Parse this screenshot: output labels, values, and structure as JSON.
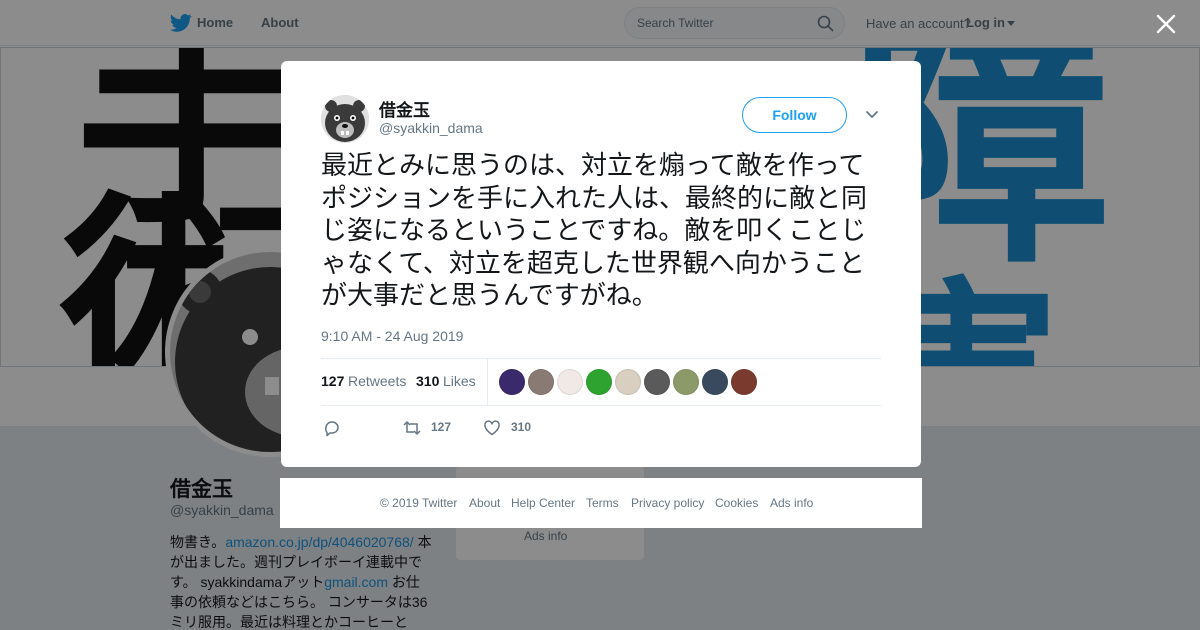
{
  "nav": {
    "home_label": "Home",
    "about_label": "About",
    "search_placeholder": "Search Twitter",
    "have_account_text": "Have an account?",
    "login_label": "Log in"
  },
  "profile_background": {
    "name": "借金玉",
    "handle": "@syakkin_dama",
    "bio": {
      "part1": "物書き。",
      "link1": "amazon.co.jp/dp/4046020768/",
      "part2": " 本が出ました。週刊プレイボーイ連載中です。 syakkindamaアット",
      "link2": "gmail.com",
      "part3": " お仕事の依頼などはこちら。 コンサータは36ミリ服用。最近は料理とかコーヒーと"
    },
    "ads_info": "Ads info",
    "banner_glyphs": [
      "手",
      "術",
      "障",
      "害"
    ]
  },
  "tweet": {
    "author_name": "借金玉",
    "author_handle": "@syakkin_dama",
    "follow_label": "Follow",
    "text": "最近とみに思うのは、対立を煽って敵を作ってポジションを手に入れた人は、最終的に敵と同じ姿になるということですね。敵を叩くことじゃなくて、対立を超克した世界観へ向かうことが大事だと思うんですがね。",
    "timestamp": "9:10 AM - 24 Aug 2019",
    "retweets_count": "127",
    "retweets_label": "Retweets",
    "likes_count": "310",
    "likes_label": "Likes",
    "action_retweet_count": "127",
    "action_like_count": "310"
  },
  "likers": [
    {
      "icon": "liker-avatar-1",
      "color": "#3b2a6b"
    },
    {
      "icon": "liker-avatar-2",
      "color": "#8a7a74"
    },
    {
      "icon": "liker-avatar-3",
      "color": "#f1e9e6"
    },
    {
      "icon": "liker-avatar-4",
      "color": "#2fa32f"
    },
    {
      "icon": "liker-avatar-5",
      "color": "#d8cfc0"
    },
    {
      "icon": "liker-avatar-6",
      "color": "#5a5a5a"
    },
    {
      "icon": "liker-avatar-7",
      "color": "#8c9a6a"
    },
    {
      "icon": "liker-avatar-8",
      "color": "#3a4a5e"
    },
    {
      "icon": "liker-avatar-9",
      "color": "#7a3a2e"
    }
  ],
  "footer": {
    "copyright": "© 2019 Twitter",
    "about": "About",
    "help_center": "Help Center",
    "terms": "Terms",
    "privacy": "Privacy policy",
    "cookies": "Cookies",
    "ads_info": "Ads info"
  },
  "colors": {
    "accent": "#1da1f2",
    "banner_blue": "#1d8fd0",
    "muted_text": "#657786"
  }
}
